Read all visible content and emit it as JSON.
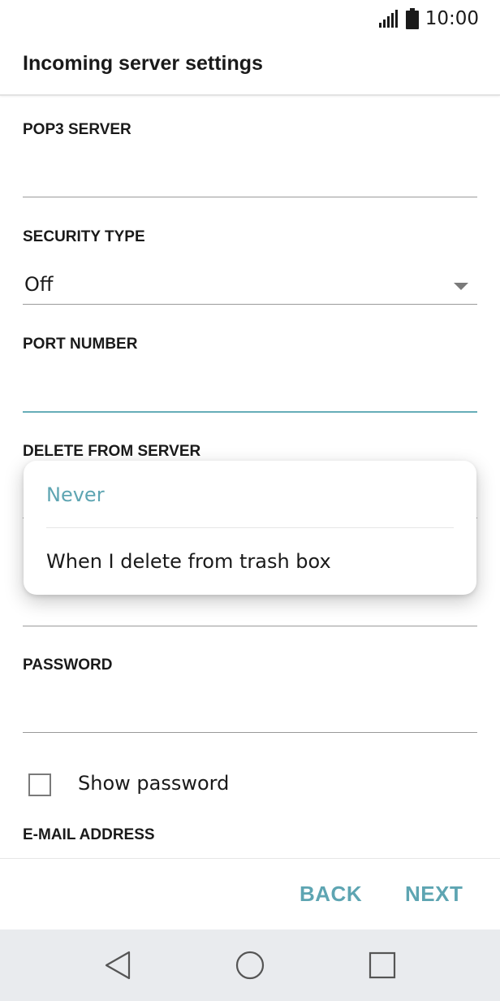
{
  "status_bar": {
    "time": "10:00"
  },
  "header": {
    "title": "Incoming server settings"
  },
  "fields": {
    "pop3_server": {
      "label": "POP3 SERVER",
      "value": ""
    },
    "security_type": {
      "label": "SECURITY TYPE",
      "value": "Off"
    },
    "port_number": {
      "label": "PORT NUMBER",
      "value": ""
    },
    "delete_from_server": {
      "label": "DELETE FROM SERVER"
    },
    "password": {
      "label": "PASSWORD",
      "value": ""
    },
    "email_address": {
      "label": "E-MAIL ADDRESS"
    }
  },
  "popup": {
    "options": [
      {
        "label": "Never",
        "selected": true
      },
      {
        "label": "When I delete from trash box",
        "selected": false
      }
    ]
  },
  "show_password": {
    "label": "Show password",
    "checked": false
  },
  "bottom_bar": {
    "back_label": "BACK",
    "next_label": "NEXT"
  },
  "nav": {
    "icons": [
      "back-triangle-icon",
      "home-circle-icon",
      "recents-square-icon"
    ]
  },
  "colors": {
    "accent": "#5ea5b2",
    "focus_line": "#66adb8",
    "nav_bg": "#e9ebee"
  }
}
